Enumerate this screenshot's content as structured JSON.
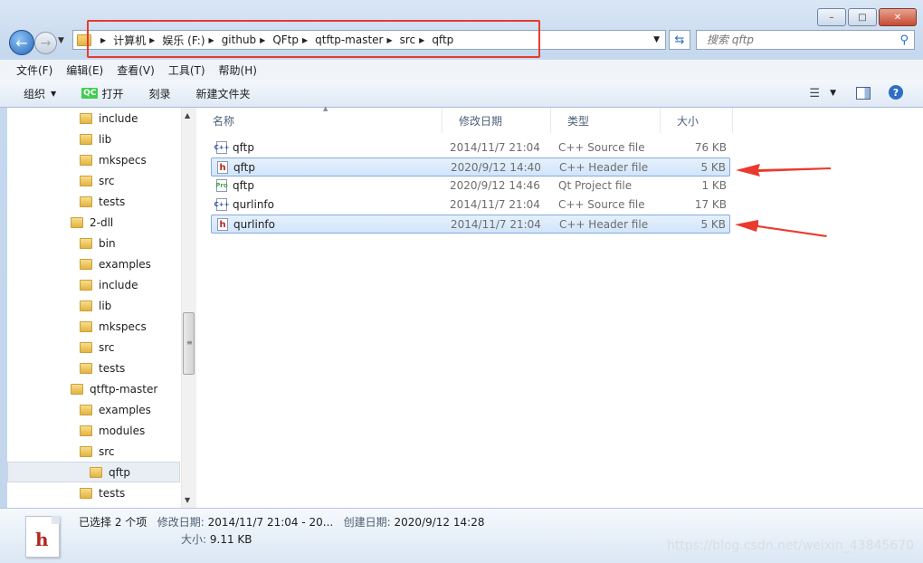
{
  "titlebar": {
    "min": "–",
    "max": "□",
    "close": "✕"
  },
  "nav": {
    "back_glyph": "←",
    "fwd_glyph": "→",
    "breadcrumb": [
      "计算机",
      "娱乐 (F:)",
      "github",
      "QFtp",
      "qtftp-master",
      "src",
      "qftp"
    ],
    "refresh_glyph": "⇆",
    "search_placeholder": "搜索 qftp"
  },
  "menu": [
    "文件(F)",
    "编辑(E)",
    "查看(V)",
    "工具(T)",
    "帮助(H)"
  ],
  "toolbar": {
    "organize": "组织",
    "open": "打开",
    "open_badge": "QC",
    "burn": "刻录",
    "new_folder": "新建文件夹",
    "help": "?"
  },
  "tree": [
    {
      "label": "include",
      "depth": 1
    },
    {
      "label": "lib",
      "depth": 1
    },
    {
      "label": "mkspecs",
      "depth": 1
    },
    {
      "label": "src",
      "depth": 1
    },
    {
      "label": "tests",
      "depth": 1
    },
    {
      "label": "2-dll",
      "depth": 0
    },
    {
      "label": "bin",
      "depth": 1
    },
    {
      "label": "examples",
      "depth": 1
    },
    {
      "label": "include",
      "depth": 1
    },
    {
      "label": "lib",
      "depth": 1
    },
    {
      "label": "mkspecs",
      "depth": 1
    },
    {
      "label": "src",
      "depth": 1
    },
    {
      "label": "tests",
      "depth": 1
    },
    {
      "label": "qtftp-master",
      "depth": 0
    },
    {
      "label": "examples",
      "depth": 1
    },
    {
      "label": "modules",
      "depth": 1
    },
    {
      "label": "src",
      "depth": 1
    },
    {
      "label": "qftp",
      "depth": 2,
      "selected": true
    },
    {
      "label": "tests",
      "depth": 1
    }
  ],
  "columns": {
    "name": "名称",
    "date": "修改日期",
    "type": "类型",
    "size": "大小"
  },
  "files": [
    {
      "name": "qftp",
      "date": "2014/11/7 21:04",
      "type": "C++ Source file",
      "size": "76 KB",
      "icon": "cpp",
      "icon_text": "C++",
      "selected": false
    },
    {
      "name": "qftp",
      "date": "2020/9/12 14:40",
      "type": "C++ Header file",
      "size": "5 KB",
      "icon": "h",
      "icon_text": "h",
      "selected": true
    },
    {
      "name": "qftp",
      "date": "2020/9/12 14:46",
      "type": "Qt Project file",
      "size": "1 KB",
      "icon": "pro",
      "icon_text": "Pro",
      "selected": false
    },
    {
      "name": "qurlinfo",
      "date": "2014/11/7 21:04",
      "type": "C++ Source file",
      "size": "17 KB",
      "icon": "cpp",
      "icon_text": "C++",
      "selected": false
    },
    {
      "name": "qurlinfo",
      "date": "2014/11/7 21:04",
      "type": "C++ Header file",
      "size": "5 KB",
      "icon": "h",
      "icon_text": "h",
      "selected": true
    }
  ],
  "details": {
    "icon_text": "h",
    "selected_count": "已选择 2 个项",
    "modified_label": "修改日期:",
    "modified_value": "2014/11/7 21:04 - 20...",
    "created_label": "创建日期:",
    "created_value": "2020/9/12 14:28",
    "size_label": "大小:",
    "size_value": "9.11 KB"
  },
  "watermark": "https://blog.csdn.net/weixin_43845670",
  "colors": {
    "annotation_red": "#ea3a2e",
    "selection_border": "#84acdd",
    "header_icon_red": "#b5261e"
  }
}
